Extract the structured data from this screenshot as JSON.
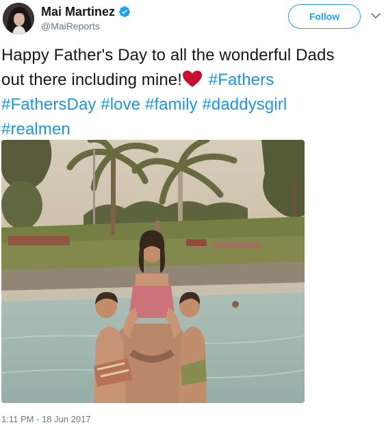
{
  "user": {
    "display_name": "Mai Martinez",
    "handle": "@MaiReports",
    "verified": true,
    "avatar_icon": "profile-photo"
  },
  "follow_button": {
    "label": "Follow"
  },
  "menu": {
    "icon": "chevron-down-icon"
  },
  "tweet": {
    "line1": "Happy Father's Day to all the wonderful Dads",
    "line2_text": "out there including mine!",
    "line2_emoji": "red-heart",
    "hashtags": [
      "#Fathers",
      "#FathersDay",
      "#love",
      "#family",
      "#daddysgirl",
      "#realmen"
    ]
  },
  "media": {
    "type": "photo"
  },
  "timestamp": "1:11 PM - 18 Jun 2017",
  "colors": {
    "link": "#1b95e0",
    "follow_border": "#1da1f2",
    "secondary_text": "#657786",
    "heart": "#c8102e"
  }
}
